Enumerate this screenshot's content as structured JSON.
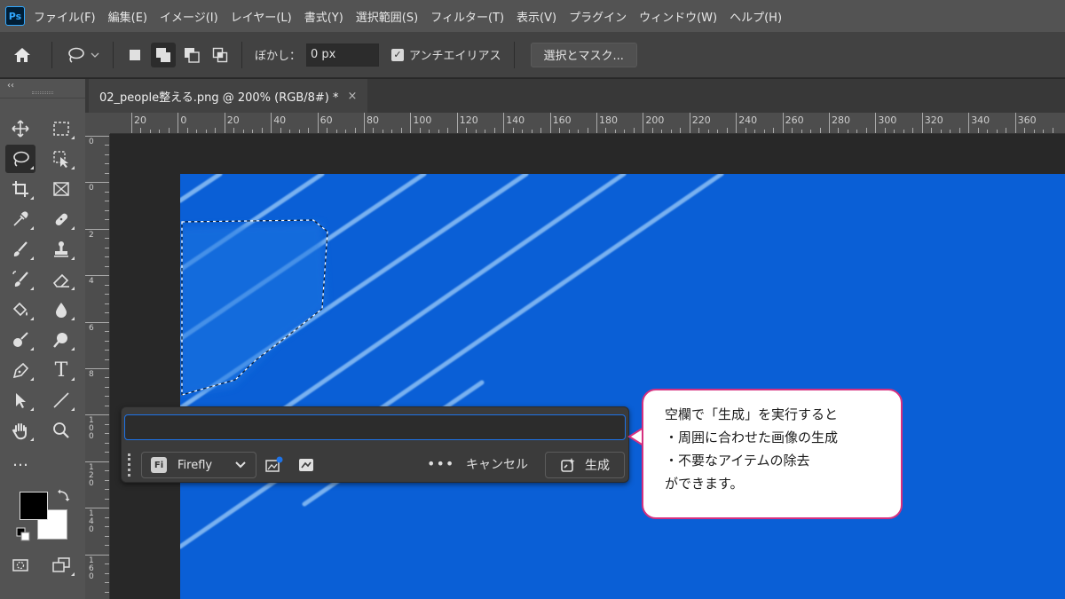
{
  "app": {
    "logo_text": "Ps"
  },
  "menu": [
    "ファイル(F)",
    "編集(E)",
    "イメージ(I)",
    "レイヤー(L)",
    "書式(Y)",
    "選択範囲(S)",
    "フィルター(T)",
    "表示(V)",
    "プラグイン",
    "ウィンドウ(W)",
    "ヘルプ(H)"
  ],
  "options": {
    "feather_label": "ぼかし：",
    "feather_value": "0 px",
    "antialias_label": "アンチエイリアス",
    "antialias_checked": true,
    "mask_button": "選択とマスク..."
  },
  "toolbar": {
    "collapse_glyph": "‹‹",
    "type_tool_glyph": "T",
    "more_glyph": "…"
  },
  "document_tab": {
    "title": "02_people整える.png @ 200% (RGB/8#) *",
    "close_glyph": "×"
  },
  "ruler": {
    "top_labels": [
      "20",
      "0",
      "20",
      "40",
      "60",
      "80",
      "100",
      "120",
      "140",
      "160",
      "180",
      "200",
      "220",
      "240",
      "260",
      "280",
      "300",
      "320",
      "340",
      "360"
    ],
    "left_labels": [
      "0",
      "0",
      "2",
      "4",
      "6",
      "8",
      "1 0 0",
      "1 2 0",
      "1 4 0",
      "1 6 0"
    ]
  },
  "task_bar": {
    "prompt_value": "",
    "prompt_placeholder": "",
    "model_label": "Firefly",
    "model_badge": "Fi",
    "more_glyph": "•••",
    "cancel_label": "キャンセル",
    "generate_label": "生成"
  },
  "callout": {
    "lines": [
      "空欄で「生成」を実行すると",
      "・周囲に合わせた画像の生成",
      "・不要なアイテムの除去",
      "ができます。"
    ],
    "border_color": "#d6307f"
  },
  "colors": {
    "accent": "#1e73e8",
    "canvas": "#0a5fd6",
    "foreground": "#000000",
    "background": "#ffffff"
  }
}
